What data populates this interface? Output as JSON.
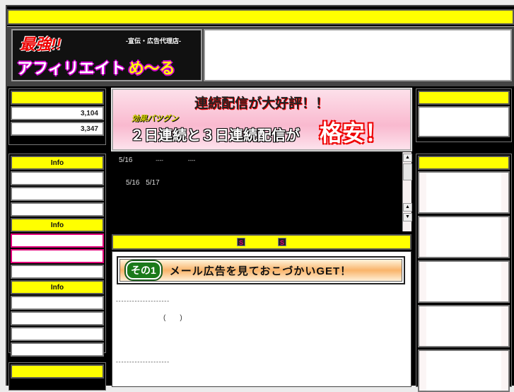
{
  "header": {
    "logo": {
      "line1": "最強!!",
      "tagline": "-宣伝・広告代理店-",
      "line2": "アフィリエイト",
      "line2b": "め〜る"
    }
  },
  "left_sidebar": {
    "stats": [
      "3,104",
      "3,347"
    ],
    "info_sections": [
      {
        "title": "Info",
        "rows": 3
      },
      {
        "title": "Info",
        "rows": 3
      },
      {
        "title": "Info",
        "rows": 4
      }
    ]
  },
  "banner": {
    "headline": "連続配信が大好評！！",
    "sub_label": "効果バツグン",
    "body": "２日連続と３日連続配信が",
    "emphasis": "格安！"
  },
  "news": {
    "line1": {
      "date": "5/16",
      "col2": "----",
      "col3": "----"
    },
    "line2": {
      "date1": "5/16",
      "date2": "5/17"
    }
  },
  "section_bar": {
    "icons": [
      "S",
      "S"
    ]
  },
  "content": {
    "ad_badge": "その1",
    "ad_title": "メール広告を見ておこづかいGET！",
    "divider": "--------------------",
    "paren": "(　　)"
  },
  "colors": {
    "accent_yellow": "#ffff00",
    "pink": "#e0007a",
    "background": "#000000"
  }
}
